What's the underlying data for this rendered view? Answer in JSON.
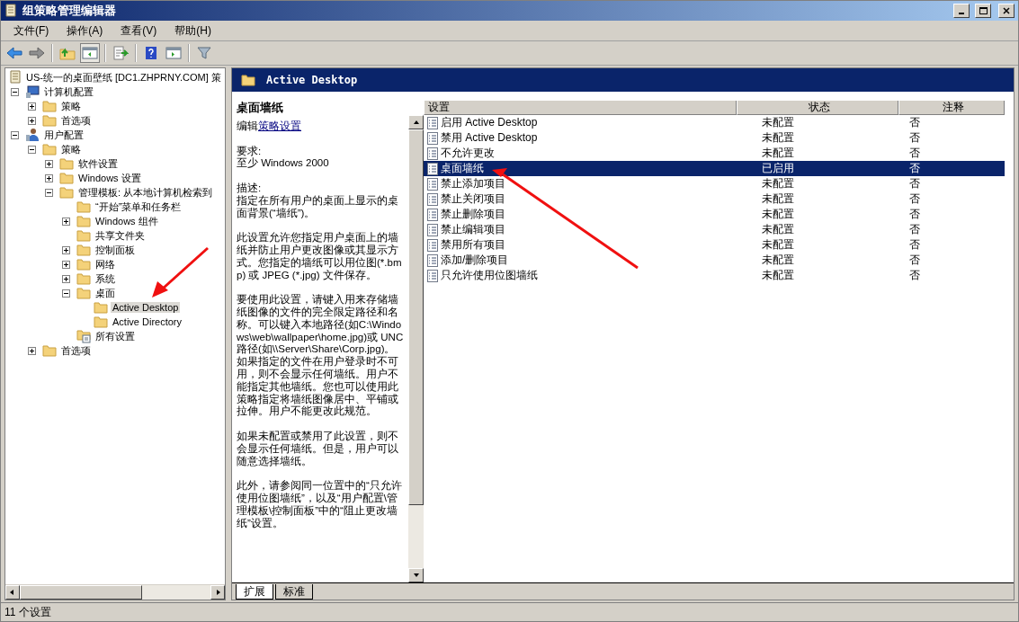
{
  "window": {
    "title": "组策略管理编辑器"
  },
  "menu": [
    "文件(F)",
    "操作(A)",
    "查看(V)",
    "帮助(H)"
  ],
  "toolbar": [
    {
      "kind": "back",
      "pressed": false
    },
    {
      "kind": "forward",
      "pressed": false
    },
    {
      "kind": "sep"
    },
    {
      "kind": "up",
      "pressed": false
    },
    {
      "kind": "tree",
      "pressed": true
    },
    {
      "kind": "sep"
    },
    {
      "kind": "export",
      "pressed": false
    },
    {
      "kind": "sep"
    },
    {
      "kind": "help",
      "pressed": false
    },
    {
      "kind": "pane",
      "pressed": false
    },
    {
      "kind": "sep"
    },
    {
      "kind": "filter",
      "pressed": false
    }
  ],
  "tree": {
    "label": "US-统一的桌面壁纸 [DC1.ZHPRNY.COM] 策",
    "kind": "scroll",
    "selected": false,
    "children": [
      {
        "label": "计算机配置",
        "kind": "computer",
        "expanded": true,
        "selected": false,
        "children": [
          {
            "label": "策略",
            "kind": "folder",
            "expanded": false,
            "selected": false
          },
          {
            "label": "首选项",
            "kind": "folder",
            "expanded": false,
            "selected": false
          }
        ]
      },
      {
        "label": "用户配置",
        "kind": "user",
        "expanded": true,
        "selected": false,
        "children": [
          {
            "label": "策略",
            "kind": "folder",
            "expanded": true,
            "selected": false,
            "children": [
              {
                "label": "软件设置",
                "kind": "folder",
                "expanded": false,
                "selected": false
              },
              {
                "label": "Windows 设置",
                "kind": "folder",
                "expanded": false,
                "selected": false
              },
              {
                "label": "管理模板: 从本地计算机检索到",
                "kind": "folder",
                "expanded": true,
                "selected": false,
                "children": [
                  {
                    "label": "“开始”菜单和任务栏",
                    "kind": "folder",
                    "selected": false
                  },
                  {
                    "label": "Windows 组件",
                    "kind": "folder",
                    "expanded": false,
                    "selected": false
                  },
                  {
                    "label": "共享文件夹",
                    "kind": "folder",
                    "selected": false
                  },
                  {
                    "label": "控制面板",
                    "kind": "folder",
                    "expanded": false,
                    "selected": false
                  },
                  {
                    "label": "网络",
                    "kind": "folder",
                    "expanded": false,
                    "selected": false
                  },
                  {
                    "label": "系统",
                    "kind": "folder",
                    "expanded": false,
                    "selected": false
                  },
                  {
                    "label": "桌面",
                    "kind": "folder",
                    "expanded": true,
                    "selected": false,
                    "children": [
                      {
                        "label": "Active Desktop",
                        "kind": "folder",
                        "selected": true
                      },
                      {
                        "label": "Active Directory",
                        "kind": "folder",
                        "selected": false
                      }
                    ]
                  },
                  {
                    "label": "所有设置",
                    "kind": "settings",
                    "selected": false
                  }
                ]
              }
            ]
          },
          {
            "label": "首选项",
            "kind": "folder",
            "expanded": false,
            "selected": false
          }
        ]
      }
    ]
  },
  "panel_header": "Active Desktop",
  "description": {
    "title": "桌面墙纸",
    "edit_prefix": "编辑",
    "edit_link": "策略设置",
    "paragraphs": [
      "要求:\n至少 Windows 2000",
      "描述:\n指定在所有用户的桌面上显示的桌面背景(“墙纸”)。",
      "此设置允许您指定用户桌面上的墙纸并防止用户更改图像或其显示方式。您指定的墙纸可以用位图(*.bmp) 或 JPEG (*.jpg) 文件保存。",
      "要使用此设置，请键入用来存储墙纸图像的文件的完全限定路径和名称。可以键入本地路径(如C:\\Windows\\web\\wallpaper\\home.jpg)或 UNC 路径(如\\\\Server\\Share\\Corp.jpg)。如果指定的文件在用户登录时不可用，则不会显示任何墙纸。用户不能指定其他墙纸。您也可以使用此策略指定将墙纸图像居中、平铺或拉伸。用户不能更改此规范。",
      "如果未配置或禁用了此设置，则不会显示任何墙纸。但是，用户可以随意选择墙纸。",
      "此外，请参阅同一位置中的“只允许使用位图墙纸”，以及“用户配置\\管理模板\\控制面板”中的“阻止更改墙纸”设置。"
    ]
  },
  "table": {
    "columns": [
      "设置",
      "状态",
      "注释"
    ],
    "rows": [
      {
        "setting": "启用 Active Desktop",
        "state": "未配置",
        "comment": "否",
        "selected": false
      },
      {
        "setting": "禁用 Active Desktop",
        "state": "未配置",
        "comment": "否",
        "selected": false
      },
      {
        "setting": "不允许更改",
        "state": "未配置",
        "comment": "否",
        "selected": false
      },
      {
        "setting": "桌面墙纸",
        "state": "已启用",
        "comment": "否",
        "selected": true
      },
      {
        "setting": "禁止添加项目",
        "state": "未配置",
        "comment": "否",
        "selected": false
      },
      {
        "setting": "禁止关闭项目",
        "state": "未配置",
        "comment": "否",
        "selected": false
      },
      {
        "setting": "禁止删除项目",
        "state": "未配置",
        "comment": "否",
        "selected": false
      },
      {
        "setting": "禁止编辑项目",
        "state": "未配置",
        "comment": "否",
        "selected": false
      },
      {
        "setting": "禁用所有项目",
        "state": "未配置",
        "comment": "否",
        "selected": false
      },
      {
        "setting": "添加/删除项目",
        "state": "未配置",
        "comment": "否",
        "selected": false
      },
      {
        "setting": "只允许使用位图墙纸",
        "state": "未配置",
        "comment": "否",
        "selected": false
      }
    ]
  },
  "bottom_tabs": [
    {
      "label": "扩展",
      "selected": true
    },
    {
      "label": "标准",
      "selected": false
    }
  ],
  "status_bar": "11 个设置"
}
